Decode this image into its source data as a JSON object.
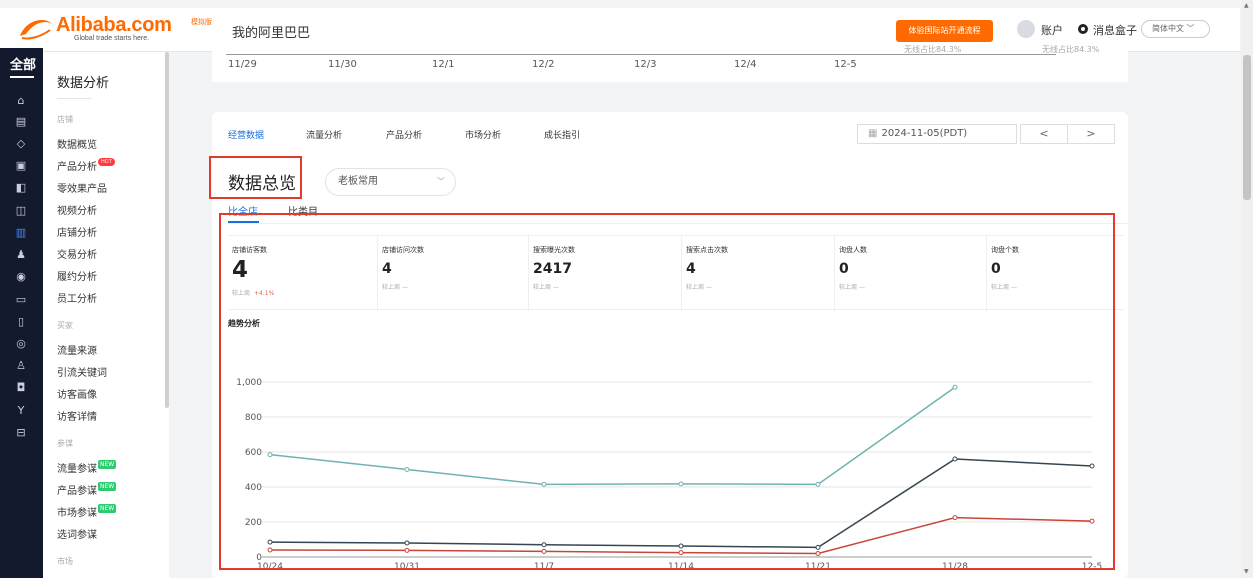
{
  "header": {
    "logo_text": "Alibaba.com",
    "logo_sub": "Global trade starts here.",
    "logo_tag": "模拟版",
    "my_alibaba": "我的阿里巴巴",
    "cta": "体验国际站开通流程",
    "account": "账户",
    "messages": "消息盒子",
    "language": "简体中文"
  },
  "rail": {
    "all_label": "全部"
  },
  "sidebar": {
    "title": "数据分析",
    "group_store": "店铺",
    "group_buyer": "买家",
    "group_staff": "参谋",
    "group_market": "市场",
    "items_store": [
      "数据概览",
      "产品分析",
      "零效果产品",
      "视频分析",
      "店铺分析",
      "交易分析",
      "履约分析",
      "员工分析"
    ],
    "hot_label": "HOT",
    "items_buyer": [
      "流量来源",
      "引流关键词",
      "访客画像",
      "访客详情"
    ],
    "items_staff": [
      "流量参谋",
      "产品参谋",
      "市场参谋",
      "选词参谋"
    ],
    "new_label": "NEW"
  },
  "prev_chart": {
    "ticks": [
      "11/29",
      "11/30",
      "12/1",
      "12/2",
      "12/3",
      "12/4",
      "12-5"
    ],
    "note_left": "无线占比84.3%",
    "note_right": "无线占比84.3%"
  },
  "tabs": [
    "经营数据",
    "流量分析",
    "产品分析",
    "市场分析",
    "成长指引"
  ],
  "date": "2024-11-05(PDT)",
  "nav": {
    "prev": "<",
    "next": ">"
  },
  "overview": {
    "title": "数据总览",
    "mode": "老板常用",
    "subtabs": [
      "比全店",
      "比类目"
    ]
  },
  "kpis": [
    {
      "label": "店铺访客数",
      "value": "4",
      "cmp": "较上周",
      "delta": "+4.1%"
    },
    {
      "label": "店铺访问次数",
      "value": "4",
      "cmp": "较上周",
      "delta": "—"
    },
    {
      "label": "搜索曝光次数",
      "value": "2417",
      "cmp": "较上周",
      "delta": "—"
    },
    {
      "label": "搜索点击次数",
      "value": "4",
      "cmp": "较上周",
      "delta": "—"
    },
    {
      "label": "询盘人数",
      "value": "0",
      "cmp": "较上周",
      "delta": "—"
    },
    {
      "label": "询盘个数",
      "value": "0",
      "cmp": "较上周",
      "delta": "—"
    }
  ],
  "trend_title": "趋势分析",
  "chart_data": {
    "type": "line",
    "x": [
      "10/24",
      "10/31",
      "11/7",
      "11/14",
      "11/21",
      "11/28",
      "12-5"
    ],
    "ylim": [
      0,
      1000
    ],
    "yticks": [
      "0",
      "200",
      "400",
      "600",
      "800",
      "1,000"
    ],
    "grid": true,
    "series": [
      {
        "color": "#6fb3b0",
        "values": [
          585,
          500,
          415,
          418,
          415,
          970,
          null
        ]
      },
      {
        "color": "#34464f",
        "values": [
          85,
          80,
          70,
          63,
          55,
          560,
          520
        ]
      },
      {
        "color": "#c7463a",
        "values": [
          40,
          38,
          32,
          25,
          20,
          225,
          205
        ]
      }
    ]
  }
}
